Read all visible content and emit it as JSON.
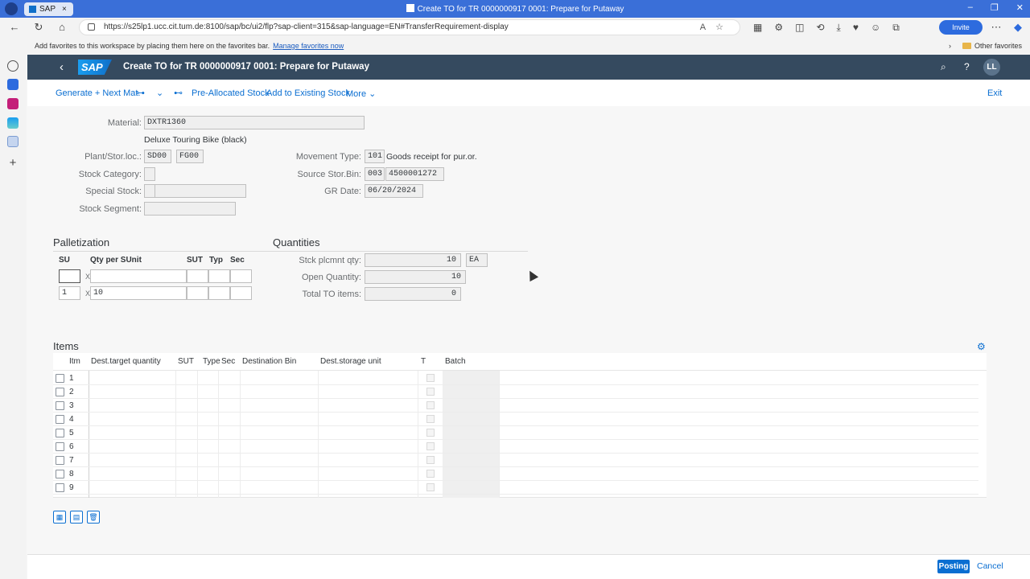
{
  "browser": {
    "tab_label": "SAP",
    "window_title": "Create TO for TR 0000000917 0001: Prepare for Putaway",
    "url": "https://s25lp1.ucc.cit.tum.de:8100/sap/bc/ui2/flp?sap-client=315&sap-language=EN#TransferRequirement-display",
    "invite_label": "Invite",
    "favorites_msg": "Add favorites to this workspace by placing them here on the favorites bar.",
    "favorites_link": "Manage favorites now",
    "other_favorites": "Other favorites"
  },
  "shell": {
    "logo": "SAP",
    "title": "Create TO for TR 0000000917 0001: Prepare for Putaway",
    "avatar": "LL"
  },
  "toolbar": {
    "generate_next": "Generate + Next Mat.",
    "pre_allocated": "Pre-Allocated Stock",
    "add_existing": "Add to Existing Stock",
    "more": "More",
    "exit": "Exit"
  },
  "header": {
    "material_label": "Material:",
    "material_value": "DXTR1360",
    "material_desc": "Deluxe Touring Bike (black)",
    "plant_label": "Plant/Stor.loc.:",
    "plant_value": "SD00",
    "storloc_value": "FG00",
    "stock_category_label": "Stock Category:",
    "special_stock_label": "Special Stock:",
    "stock_segment_label": "Stock Segment:",
    "movement_type_label": "Movement Type:",
    "movement_type_value": "101",
    "movement_type_desc": "Goods receipt for pur.or.",
    "source_bin_label": "Source Stor.Bin:",
    "source_bin_type": "003",
    "source_bin_value": "4500001272",
    "gr_date_label": "GR Date:",
    "gr_date_value": "06/20/2024"
  },
  "palletization": {
    "title": "Palletization",
    "col_su": "SU",
    "col_qty": "Qty per SUnit",
    "col_sut": "SUT",
    "col_typ": "Typ",
    "col_sec": "Sec",
    "x": "X",
    "row2_su": "1",
    "row2_qty": "10"
  },
  "quantities": {
    "title": "Quantities",
    "stck_label": "Stck plcmnt qty:",
    "stck_value": "10",
    "stck_unit": "EA",
    "open_label": "Open Quantity:",
    "open_value": "10",
    "total_label": "Total TO items:",
    "total_value": "0"
  },
  "items": {
    "title": "Items",
    "columns": [
      "Itm",
      "Dest.target quantity",
      "SUT",
      "Type",
      "Sec",
      "Destination Bin",
      "Dest.storage unit",
      "T",
      "Batch"
    ],
    "rows": [
      "1",
      "2",
      "3",
      "4",
      "5",
      "6",
      "7",
      "8",
      "9"
    ]
  },
  "footer": {
    "posting": "Posting",
    "cancel": "Cancel"
  },
  "colors": {
    "shell": "#354a5f",
    "accent": "#0a6ed1",
    "browser": "#3a6fd8"
  }
}
